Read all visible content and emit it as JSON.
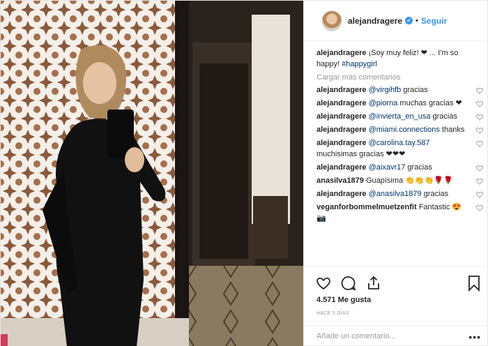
{
  "post": {
    "username": "alejandragere",
    "follow_label": "Seguir",
    "dot": "•",
    "verified_mark": "✓",
    "caption_user": "alejandragere",
    "caption_text": " ¡Soy muy feliz! ❤ ... I'm so happy! ",
    "caption_tag": "#happygirl",
    "load_more": "Cargar más comentarios",
    "likes": "4.571 Me gusta",
    "time": "HACE 5 DÍAS",
    "add_comment_placeholder": "Añade un comentario...",
    "menu_glyph": "•••"
  },
  "comments": [
    {
      "user": "alejandragere",
      "mention": "@virgihfb",
      "text": " gracias"
    },
    {
      "user": "alejandragere",
      "mention": "@piorna",
      "text": " muchas gracias ❤"
    },
    {
      "user": "alejandragere",
      "mention": "@invierta_en_usa",
      "text": " gracias"
    },
    {
      "user": "alejandragere",
      "mention": "@miami.connections",
      "text": " thanks"
    },
    {
      "user": "alejandragere",
      "mention": "@carolina.tay.587",
      "text": " muchisimas gracias ❤❤❤"
    },
    {
      "user": "alejandragere",
      "mention": "@aixavr17",
      "text": " gracias"
    },
    {
      "user": "anasilva1879",
      "mention": "",
      "text": " Guapísima 👏👏👏🌹🌹"
    },
    {
      "user": "alejandragere",
      "mention": "@anasilva1879",
      "text": " gracias"
    },
    {
      "user": "veganforbommelmuetzenfit",
      "mention": "",
      "text": " Fantastic 😍📷"
    }
  ],
  "icons": [
    "heart-icon",
    "comment-icon",
    "share-icon",
    "bookmark-icon",
    "verified-badge-icon"
  ],
  "colors": {
    "link": "#3897f0",
    "mention": "#003569",
    "muted": "#999999",
    "text": "#262626"
  }
}
